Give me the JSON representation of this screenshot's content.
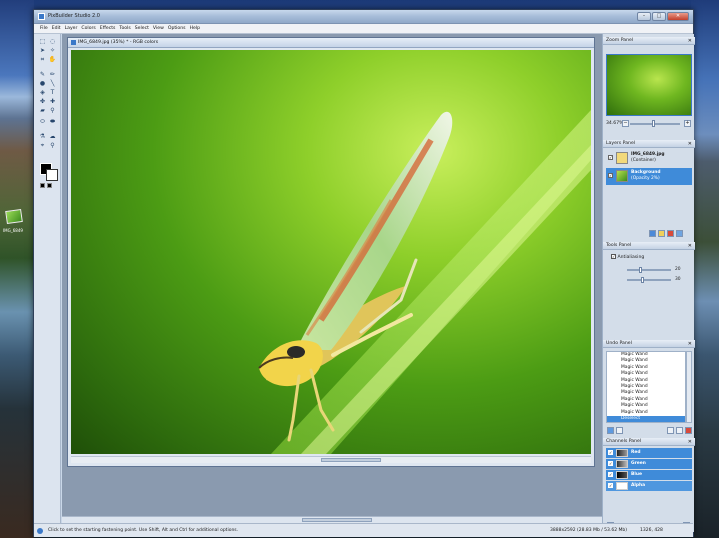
{
  "window": {
    "title": "PixBuilder Studio 2.0"
  },
  "menu": [
    "File",
    "Edit",
    "Layer",
    "Colors",
    "Effects",
    "Tools",
    "Select",
    "View",
    "Options",
    "Help"
  ],
  "desktop": {
    "icon_label": "IMG_6849"
  },
  "document": {
    "title": "IMG_6849.jpg (35%) * - RGB colors"
  },
  "zoom_panel": {
    "title": "Zoom Panel",
    "zoom": "34.67%",
    "minus": "−",
    "plus": "+"
  },
  "layers_panel": {
    "title": "Layers Panel",
    "layers": [
      {
        "name": "IMG_6849.jpg",
        "sub": "(Container)",
        "selected": false
      },
      {
        "name": "Background",
        "sub": "(Opacity 2%)",
        "selected": true
      }
    ]
  },
  "tools_panel": {
    "title": "Tools Panel",
    "antialiasing": "Antialiasing",
    "value1": "20",
    "value2": "30"
  },
  "undo_panel": {
    "title": "Undo Panel",
    "items": [
      "Magic Wand",
      "Magic Wand",
      "Magic Wand",
      "Magic Wand",
      "Magic Wand",
      "Magic Wand",
      "Magic Wand",
      "Magic Wand",
      "Magic Wand",
      "Magic Wand",
      "Deselect"
    ]
  },
  "channels_panel": {
    "title": "Channels Panel",
    "channels": [
      "Red",
      "Green",
      "Blue",
      "Alpha"
    ]
  },
  "status": {
    "hint": "Click to set the starting fastening point. Use Shift, Alt and Ctrl for additional options.",
    "dimensions": "3888x2592 (28.83 Mb / 53.62 Mb)",
    "coords": "1326, 428"
  },
  "colors": {
    "accent": "#3f8bd9",
    "title_bar": "#a6bcd8"
  }
}
